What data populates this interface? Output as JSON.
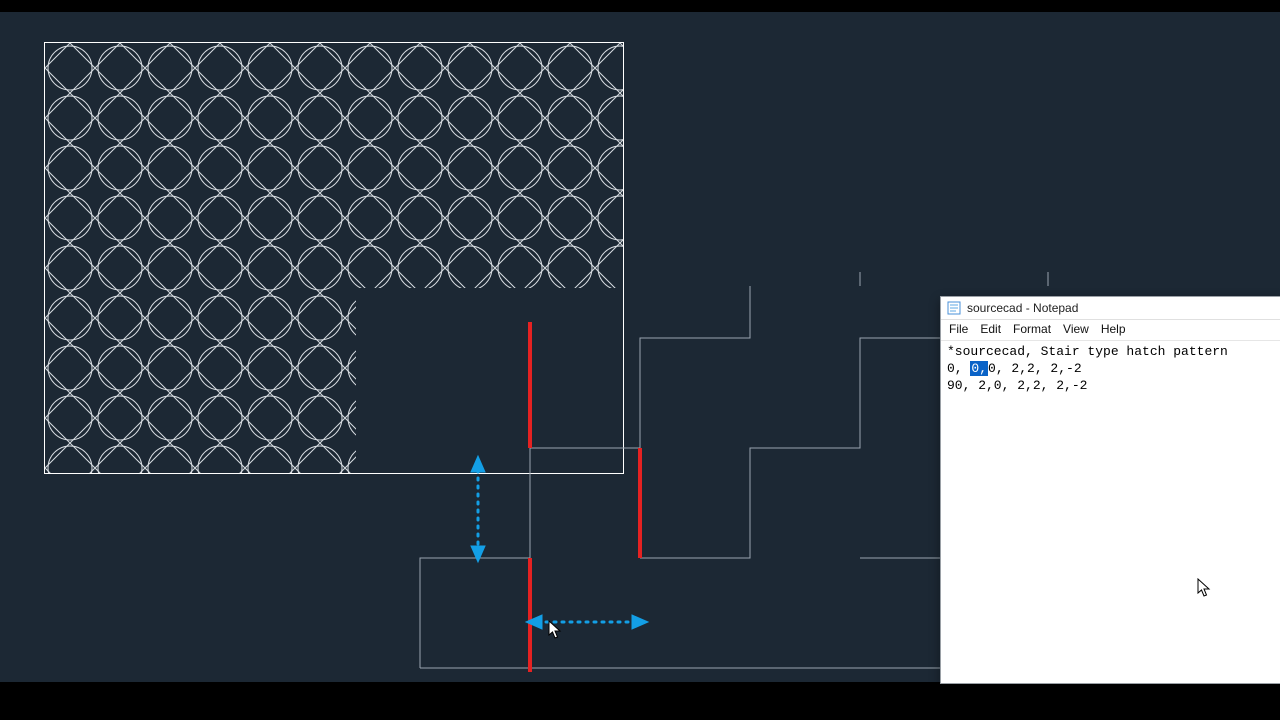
{
  "notepad": {
    "title": "sourcecad - Notepad",
    "menu": {
      "file": "File",
      "edit": "Edit",
      "format": "Format",
      "view": "View",
      "help": "Help"
    },
    "line1": "*sourcecad, Stair type hatch pattern",
    "line2_pre": "0, ",
    "line2_sel": "0,",
    "line2_post": "0, 2,2, 2,-2",
    "line3": "90, 2,0, 2,2, 2,-2"
  },
  "hatch": {
    "tile_size": 50,
    "circle_r": 22
  },
  "stair": {
    "unit": 110,
    "red_stroke": 4,
    "gray_stroke": 1
  },
  "colors": {
    "cad_bg": "#1c2834",
    "line_gray": "#9aa5af",
    "line_white": "#e6e6e6",
    "red": "#e52222",
    "blue": "#139fe6"
  }
}
